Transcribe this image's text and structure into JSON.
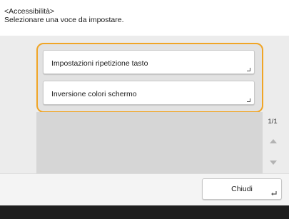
{
  "header": {
    "title": "<Accessibilità>",
    "instruction": "Selezionare una voce da impostare."
  },
  "list": {
    "items": [
      {
        "label": "Impostazioni ripetizione tasto"
      },
      {
        "label": "Inversione colori schermo"
      }
    ]
  },
  "pager": {
    "page_indicator": "1/1"
  },
  "footer": {
    "close_label": "Chiudi"
  },
  "colors": {
    "highlight_border": "#f0a526",
    "background": "#ececec"
  },
  "icons": [
    "corner-arrow-icon",
    "scroll-up-icon",
    "scroll-down-icon",
    "enter-icon"
  ]
}
